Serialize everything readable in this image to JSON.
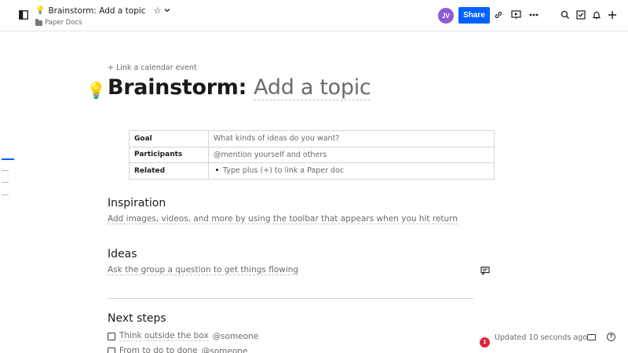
{
  "header": {
    "title_emoji": "💡",
    "doc_title": "Brainstorm: Add a topic",
    "breadcrumb_folder": "Paper Docs",
    "avatar_initials": "JV",
    "avatar_color": "#8e5bd6",
    "share_label": "Share",
    "share_color": "#0061fe",
    "icons": [
      "sidebar-toggle-icon",
      "star-icon",
      "chevron-down-icon",
      "link-icon",
      "present-icon",
      "more-icon",
      "search-icon",
      "checklist-icon",
      "bell-icon",
      "plus-icon"
    ]
  },
  "doc": {
    "calendar_link": "+ Link a calendar event",
    "title_emoji": "💡",
    "title_prefix": "Brainstorm: ",
    "title_placeholder": "Add a topic",
    "table": [
      {
        "key": "Goal",
        "value": "What kinds of ideas do you want?"
      },
      {
        "key": "Participants",
        "value": "@mention yourself and others"
      },
      {
        "key": "Related",
        "value": "Type plus (+) to link a Paper doc"
      }
    ],
    "sections": [
      {
        "heading": "Inspiration",
        "body": "Add images, videos, and more by using the toolbar that appears when you hit return"
      },
      {
        "heading": "Ideas",
        "body": "Ask the group a question to get things flowing"
      },
      {
        "heading": "Next steps"
      }
    ],
    "todos": [
      {
        "text": "Think outside the box",
        "mention": "@someone"
      },
      {
        "text": "From to do to done",
        "mention": "@someone"
      }
    ]
  },
  "status": {
    "notification_count": "1",
    "updated_text": "Updated 10 seconds ago",
    "help_glyph": "?"
  }
}
